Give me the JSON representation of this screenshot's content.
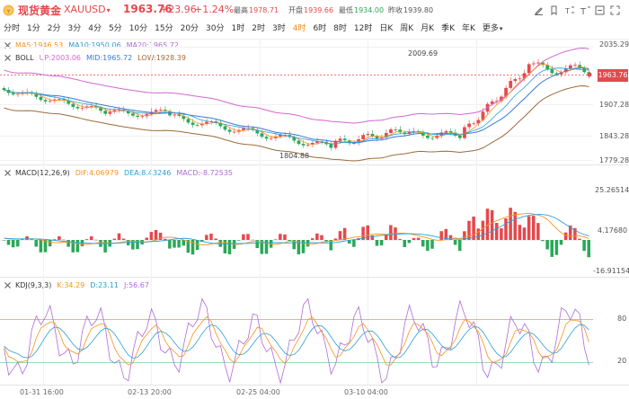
{
  "header": {
    "title": "现货黄金",
    "symbol": "XAUUSD",
    "symbol_caret": "▾",
    "price": "1963.76",
    "change": "+23.96",
    "change_pct": "+1.24%",
    "high_label": "最高",
    "high_value": "1978.71",
    "open_label": "开盘",
    "open_value": "1939.66",
    "low_label": "最低",
    "low_value": "1934.00",
    "prev_label": "昨收",
    "prev_value": "1939.80",
    "tool_icons": [
      "marker-icon",
      "bookmark-icon",
      "text-size-small-icon",
      "text-size-large-icon",
      "fullscreen-icon",
      "expand-icon"
    ]
  },
  "periods": {
    "items": [
      "分时",
      "1分",
      "2分",
      "3分",
      "4分",
      "5分",
      "10分",
      "15分",
      "20分",
      "30分",
      "1时",
      "2时",
      "3时",
      "4时",
      "6时",
      "8时",
      "12时",
      "日K",
      "周K",
      "月K",
      "季K",
      "年K",
      "更多"
    ],
    "active": "4时",
    "more_caret": "▾"
  },
  "indicators": {
    "ma": {
      "ma5": "MA5:1946.53",
      "ma10": "MA10:1950.06",
      "ma20": "MA20:1965.72"
    },
    "boll": {
      "name": "BOLL",
      "up": "UP:2003.06",
      "mid": "MID:1965.72",
      "low": "LOW:1928.39"
    },
    "macd": {
      "name": "MACD(12,26,9)",
      "dif": "DIF:4.06979",
      "dea": "DEA:8.43246",
      "macd": "MACD:-8.72535"
    },
    "kdj": {
      "name": "KDJ(9,3,3)",
      "k": "K:34.29",
      "d": "D:23.11",
      "j": "J:56.67"
    }
  },
  "price_axis": [
    "2035.29",
    "1907.28",
    "1843.28",
    "1779.28"
  ],
  "current_price_tag": "1963.76",
  "annotations": {
    "high": "2009.69",
    "low": "1804.88"
  },
  "macd_axis": [
    "25.26514",
    "4.17680",
    "-16.91154"
  ],
  "kdj_axis": [
    "80",
    "20"
  ],
  "time_axis": [
    "01-31 16:00",
    "02-13 20:00",
    "02-25 04:00",
    "03-10 04:00"
  ],
  "colors": {
    "up": "#e5484d",
    "down": "#2aa858",
    "ma5": "#f7931e",
    "ma10": "#2b9fd6",
    "ma20": "#b06ad9",
    "boll_up": "#d466d4",
    "boll_mid": "#3a7bd5",
    "boll_low": "#9c6b3a",
    "accent": "#f08c1a"
  }
}
